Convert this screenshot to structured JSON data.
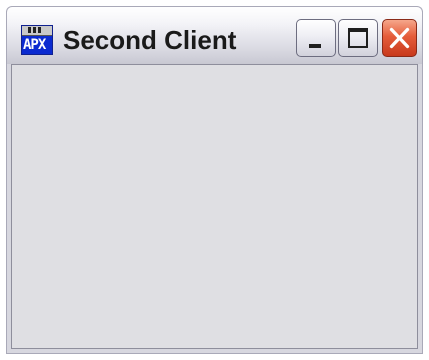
{
  "window": {
    "title": "Second Client",
    "icon": "java-app-icon",
    "controls": {
      "minimize": "minimize-icon",
      "maximize": "maximize-icon",
      "close": "close-icon"
    },
    "close_color": "#e55d3b",
    "client_background": "#dfdfe3"
  }
}
